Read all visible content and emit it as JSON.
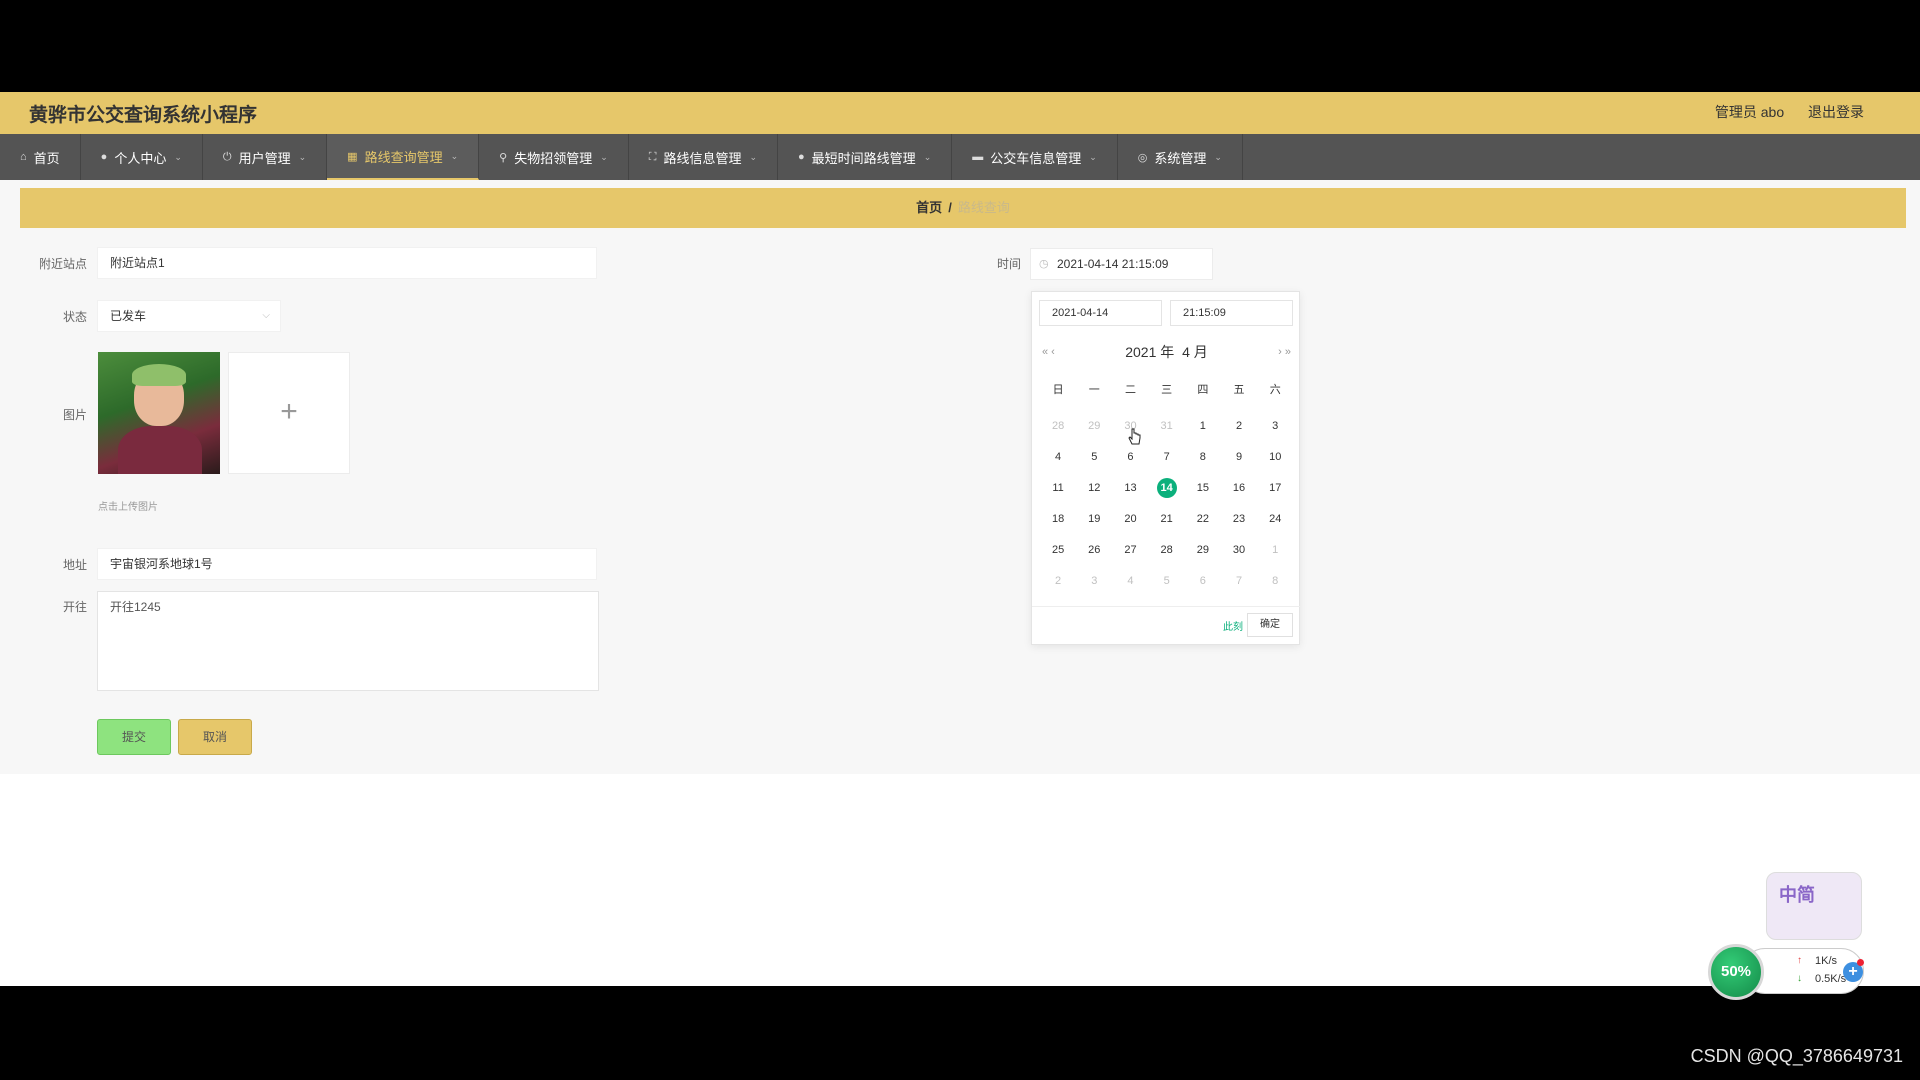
{
  "app": {
    "title": "黄骅市公交查询系统小程序"
  },
  "topbar": {
    "user_label": "管理员 abo",
    "logout_label": "退出登录"
  },
  "nav": {
    "items": [
      {
        "label": "首页",
        "icon": "home-icon"
      },
      {
        "label": "个人中心",
        "icon": "person-icon"
      },
      {
        "label": "用户管理",
        "icon": "power-icon"
      },
      {
        "label": "路线查询管理",
        "icon": "calendar-icon",
        "active": true
      },
      {
        "label": "失物招领管理",
        "icon": "search-icon"
      },
      {
        "label": "路线信息管理",
        "icon": "expand-icon"
      },
      {
        "label": "最短时间路线管理",
        "icon": "mic-icon"
      },
      {
        "label": "公交车信息管理",
        "icon": "bus-icon"
      },
      {
        "label": "系统管理",
        "icon": "info-icon"
      }
    ]
  },
  "breadcrumb": {
    "home": "首页",
    "separator": "/",
    "current": "路线查询"
  },
  "form": {
    "nearby_station": {
      "label": "附近站点",
      "value": "附近站点1"
    },
    "status": {
      "label": "状态",
      "value": "已发车"
    },
    "image": {
      "label": "图片",
      "hint": "点击上传图片",
      "upload_glyph": "+"
    },
    "address": {
      "label": "地址",
      "value": "宇宙银河系地球1号"
    },
    "destination": {
      "label": "开往",
      "value": "开往1245"
    },
    "time": {
      "label": "时间",
      "value": "2021-04-14 21:15:09"
    },
    "submit_label": "提交",
    "cancel_label": "取消"
  },
  "datepicker": {
    "date_value": "2021-04-14",
    "time_value": "21:15:09",
    "header_year": "2021 年",
    "header_month": "4 月",
    "prev_glyph": "« ‹",
    "next_glyph": "› »",
    "weekdays": [
      "日",
      "一",
      "二",
      "三",
      "四",
      "五",
      "六"
    ],
    "days": [
      [
        "28",
        "29",
        "30",
        "31",
        "1",
        "2",
        "3"
      ],
      [
        "4",
        "5",
        "6",
        "7",
        "8",
        "9",
        "10"
      ],
      [
        "11",
        "12",
        "13",
        "14",
        "15",
        "16",
        "17"
      ],
      [
        "18",
        "19",
        "20",
        "21",
        "22",
        "23",
        "24"
      ],
      [
        "25",
        "26",
        "27",
        "28",
        "29",
        "30",
        "1"
      ],
      [
        "2",
        "3",
        "4",
        "5",
        "6",
        "7",
        "8"
      ]
    ],
    "selected_day": "14",
    "now_label": "此刻",
    "confirm_label": "确定"
  },
  "widget": {
    "percent": "50%",
    "pet_label": "中简",
    "upload_speed": "1K/s",
    "download_speed": "0.5K/s"
  },
  "watermark": "CSDN @QQ_3786649731",
  "colors": {
    "header": "#e6c76a",
    "nav": "#545454",
    "accent_green": "#0bb07c"
  }
}
